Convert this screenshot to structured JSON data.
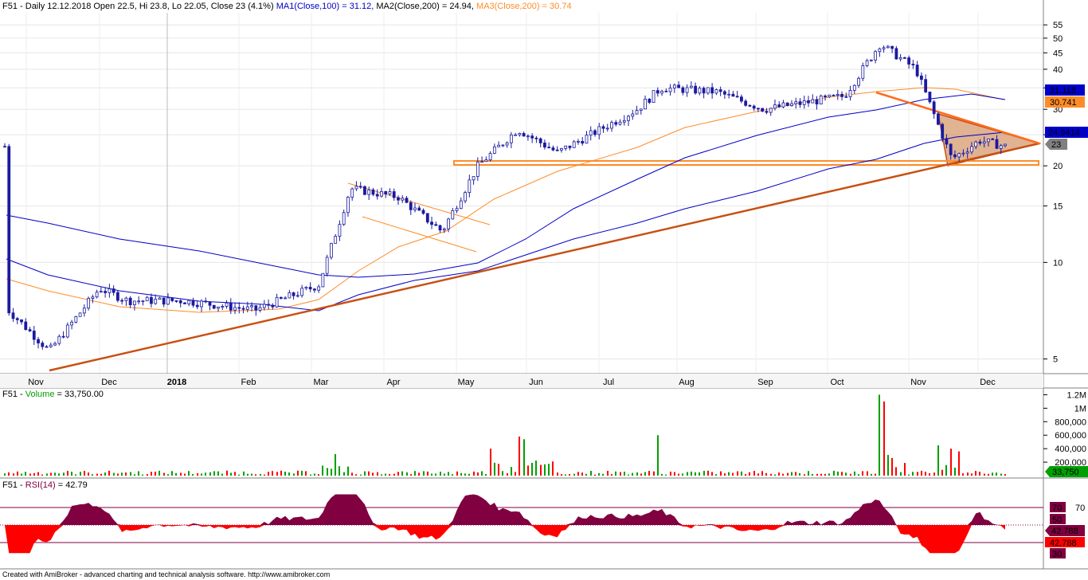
{
  "header": {
    "symbol": "F51",
    "sep": " - ",
    "info": "Daily 12.12.2018 Open 22.5, Hi 23.8, Lo 22.05, Close 23 (4.1%)",
    "ma1": "MA1(Close,100) = 31.12,",
    "ma2": "MA2(Close,200) = 24.94,",
    "ma3": "MA3(Close,200) = 30.74"
  },
  "volume_header": {
    "symbol": "F51",
    "sep": " - ",
    "label": "Volume",
    "value": " = 33,750.00"
  },
  "rsi_header": {
    "symbol": "F51",
    "sep": " - ",
    "label": "RSI(14)",
    "value": " = 42.79"
  },
  "footer": "Created with AmiBroker - advanced charting and technical analysis software. http://www.amibroker.com",
  "colors": {
    "ma1": "#0000c8",
    "ma2": "#0000c8",
    "ma3": "#ff8c28",
    "trend": "#c85014",
    "support": "#ff8c28",
    "candle": "#1a1aa0",
    "vol_up": "#00a000",
    "vol_down": "#ff0000",
    "rsi": "#800040",
    "rsi_neg": "#ff0000"
  },
  "price_badges": {
    "ma1": "31.118",
    "ma3": "30.741",
    "ma2": "24.9414",
    "close": "23"
  },
  "volume_badge": "33,750",
  "rsi_badges": {
    "upper": "70",
    "mid": "50",
    "value": "42.788",
    "value2": "42.788",
    "lower": "30"
  },
  "chart_data": [
    {
      "type": "candlestick",
      "title": "F51 - Daily",
      "y_scale": "log",
      "y_ticks": [
        5,
        10,
        15,
        20,
        25,
        30,
        35,
        40,
        45,
        50,
        55
      ],
      "x_labels": [
        "Nov",
        "Dec",
        "2018",
        "Feb",
        "Mar",
        "Apr",
        "May",
        "Jun",
        "Jul",
        "Aug",
        "Sep",
        "Oct",
        "Nov",
        "Dec"
      ],
      "close_points": [
        [
          "Nov",
          7.2
        ],
        [
          "Nov",
          5.3
        ],
        [
          "Dec",
          8.3
        ],
        [
          "Dec",
          7.6
        ],
        [
          "2018",
          7.6
        ],
        [
          "Feb",
          7.1
        ],
        [
          "Mar",
          8.5
        ],
        [
          "Mar",
          17.0
        ],
        [
          "Apr",
          16.0
        ],
        [
          "May",
          12.5
        ],
        [
          "May",
          20.0
        ],
        [
          "Jun",
          26.0
        ],
        [
          "Jun",
          22.0
        ],
        [
          "Jul",
          30.0
        ],
        [
          "Jul",
          35.0
        ],
        [
          "Aug",
          34.0
        ],
        [
          "Sep",
          30.0
        ],
        [
          "Oct",
          33.0
        ],
        [
          "Oct",
          48.0
        ],
        [
          "Nov",
          40.0
        ],
        [
          "Nov",
          21.0
        ],
        [
          "Dec",
          24.0
        ],
        [
          "Dec",
          23.0
        ]
      ],
      "series": [
        {
          "name": "MA1(Close,100)",
          "last": 31.12
        },
        {
          "name": "MA2(Close,200)",
          "last": 24.94
        },
        {
          "name": "MA3(Close,200)",
          "last": 30.74
        }
      ],
      "annotations": [
        "rising trendline",
        "support at 20",
        "descending channel Apr-May",
        "symmetrical triangle Nov-Dec"
      ]
    },
    {
      "type": "bar",
      "title": "Volume",
      "y_ticks": [
        "200,000",
        "400,000",
        "600,000",
        "800,000",
        "1M",
        "1.2M"
      ],
      "last": 33750,
      "peaks": [
        {
          "month": "Oct",
          "value": 1200000
        },
        {
          "month": "Jun",
          "value": 580000
        },
        {
          "month": "Aug",
          "value": 600000
        },
        {
          "month": "Nov",
          "value": 450000
        }
      ]
    },
    {
      "type": "area",
      "title": "RSI(14)",
      "y_ticks": [
        30,
        50,
        70
      ],
      "reference_lines": [
        30,
        70
      ],
      "last": 42.79
    }
  ]
}
